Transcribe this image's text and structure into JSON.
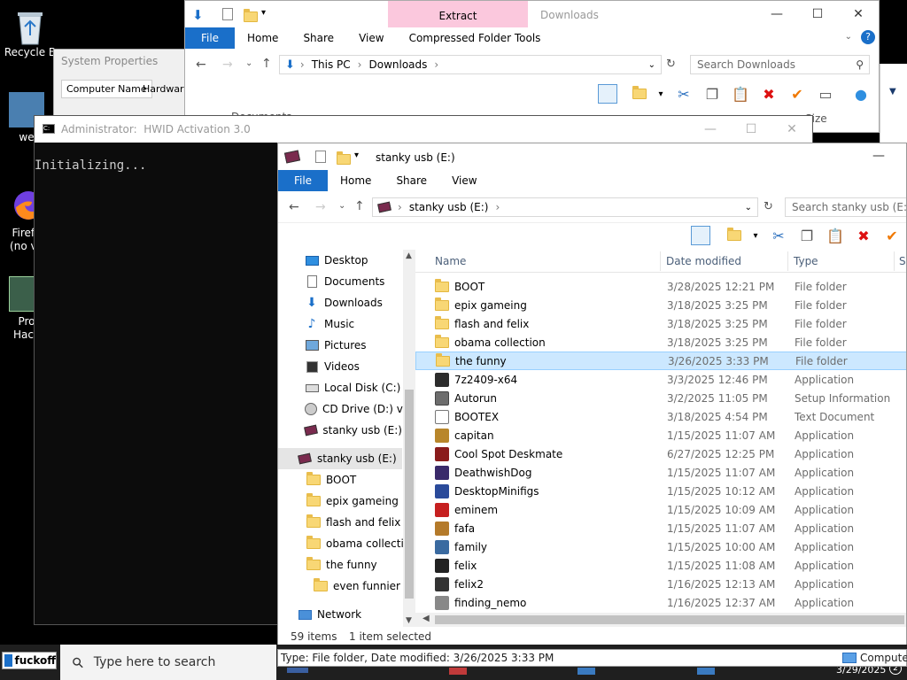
{
  "desktop": {
    "icons": [
      {
        "label": "Recycle B"
      },
      {
        "label": "we"
      },
      {
        "label": "Firefo\n(no ve"
      },
      {
        "label": "Pro\nHack"
      }
    ]
  },
  "sys_props": {
    "title": "System Properties",
    "tabs": [
      "Computer Name",
      "Hardware"
    ]
  },
  "downloads": {
    "title": "Downloads",
    "contextual_tab": "Extract",
    "tabs": [
      "File",
      "Home",
      "Share",
      "View",
      "Compressed Folder Tools"
    ],
    "breadcrumb": [
      "This PC",
      "Downloads"
    ],
    "search_placeholder": "Search Downloads",
    "col_hint_1": "Documents",
    "col_hint_2": "Size"
  },
  "cmd": {
    "title": "Administrator:  HWID Activation 3.0",
    "output": "Initializing..."
  },
  "explorer": {
    "title": "stanky usb (E:)",
    "tabs": [
      "File",
      "Home",
      "Share",
      "View"
    ],
    "breadcrumb": "stanky usb (E:)",
    "search_placeholder": "Search stanky usb (E:)",
    "columns": {
      "name": "Name",
      "date": "Date modified",
      "type": "Type",
      "size": "Si"
    },
    "nav": [
      {
        "label": "Desktop",
        "icon": "desktop-icon"
      },
      {
        "label": "Documents",
        "icon": "documents-icon"
      },
      {
        "label": "Downloads",
        "icon": "downloads-icon"
      },
      {
        "label": "Music",
        "icon": "music-icon"
      },
      {
        "label": "Pictures",
        "icon": "pictures-icon"
      },
      {
        "label": "Videos",
        "icon": "videos-icon"
      },
      {
        "label": "Local Disk (C:)",
        "icon": "disk-icon"
      },
      {
        "label": "CD Drive (D:) virt",
        "icon": "cd-icon"
      },
      {
        "label": "stanky usb (E:)",
        "icon": "usb-icon"
      },
      {
        "label": "stanky usb (E:)",
        "icon": "usb-icon"
      },
      {
        "label": "BOOT",
        "icon": "folder-icon"
      },
      {
        "label": "epix gameing",
        "icon": "folder-icon"
      },
      {
        "label": "flash and felix",
        "icon": "folder-icon"
      },
      {
        "label": "obama collectio",
        "icon": "folder-icon"
      },
      {
        "label": "the funny",
        "icon": "folder-icon"
      },
      {
        "label": "even funnier",
        "icon": "folder-icon"
      },
      {
        "label": "Network",
        "icon": "network-icon"
      }
    ],
    "files": [
      {
        "name": "BOOT",
        "date": "3/28/2025 12:21 PM",
        "type": "File folder",
        "icon": "folder-icon"
      },
      {
        "name": "epix gameing",
        "date": "3/18/2025 3:25 PM",
        "type": "File folder",
        "icon": "folder-icon"
      },
      {
        "name": "flash and felix",
        "date": "3/18/2025 3:25 PM",
        "type": "File folder",
        "icon": "folder-icon"
      },
      {
        "name": "obama collection",
        "date": "3/18/2025 3:25 PM",
        "type": "File folder",
        "icon": "folder-icon"
      },
      {
        "name": "the funny",
        "date": "3/26/2025 3:33 PM",
        "type": "File folder",
        "icon": "folder-icon"
      },
      {
        "name": "7z2409-x64",
        "date": "3/3/2025 12:46 PM",
        "type": "Application",
        "icon": "archive-icon"
      },
      {
        "name": "Autorun",
        "date": "3/2/2025 11:05 PM",
        "type": "Setup Information",
        "icon": "setup-icon"
      },
      {
        "name": "BOOTEX",
        "date": "3/18/2025 4:54 PM",
        "type": "Text Document",
        "icon": "text-icon"
      },
      {
        "name": "capitan",
        "date": "1/15/2025 11:07 AM",
        "type": "Application",
        "icon": "app-icon"
      },
      {
        "name": "Cool Spot Deskmate",
        "date": "6/27/2025 12:25 PM",
        "type": "Application",
        "icon": "app-icon"
      },
      {
        "name": "DeathwishDog",
        "date": "1/15/2025 11:07 AM",
        "type": "Application",
        "icon": "app-icon"
      },
      {
        "name": "DesktopMinifigs",
        "date": "1/15/2025 10:12 AM",
        "type": "Application",
        "icon": "app-icon"
      },
      {
        "name": "eminem",
        "date": "1/15/2025 10:09 AM",
        "type": "Application",
        "icon": "app-icon"
      },
      {
        "name": "fafa",
        "date": "1/15/2025 11:07 AM",
        "type": "Application",
        "icon": "app-icon"
      },
      {
        "name": "family",
        "date": "1/15/2025 10:00 AM",
        "type": "Application",
        "icon": "app-icon"
      },
      {
        "name": "felix",
        "date": "1/15/2025 11:08 AM",
        "type": "Application",
        "icon": "app-icon"
      },
      {
        "name": "felix2",
        "date": "1/16/2025 12:13 AM",
        "type": "Application",
        "icon": "app-icon"
      },
      {
        "name": "finding_nemo",
        "date": "1/16/2025 12:37 AM",
        "type": "Application",
        "icon": "app-icon"
      }
    ],
    "status_count": "59 items",
    "status_selected": "1 item selected"
  },
  "infotip": {
    "text": "Type: File folder, Date modified: 3/26/2025 3:33 PM",
    "computer_label": "Computer"
  },
  "taskbar": {
    "start_label": "fuckoff",
    "search_placeholder": "Type here to search",
    "date": "3/29/2025"
  }
}
